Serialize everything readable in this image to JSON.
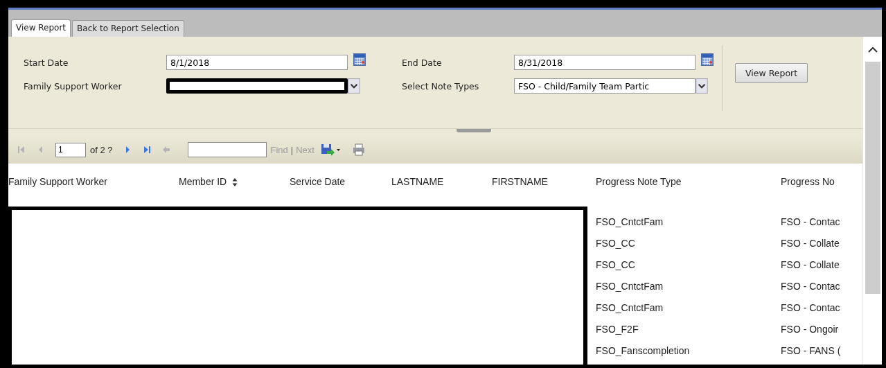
{
  "tabs": [
    {
      "label": "View Report",
      "selected": true
    },
    {
      "label": "Back to Report Selection",
      "selected": false
    }
  ],
  "parameters": {
    "start_date": {
      "label": "Start Date",
      "value": "8/1/2018"
    },
    "end_date": {
      "label": "End Date",
      "value": "8/31/2018"
    },
    "family_support_worker": {
      "label": "Family Support Worker",
      "redacted": true
    },
    "note_types": {
      "label": "Select Note Types",
      "value": "FSO - Child/Family Team Partic"
    },
    "button": "View Report"
  },
  "toolbar": {
    "nav": [
      {
        "kind": "first",
        "disabled": true
      },
      {
        "kind": "prev",
        "disabled": true
      }
    ],
    "page": "1",
    "page_count": "of 2 ?",
    "nav_after": [
      {
        "kind": "next",
        "disabled": false
      },
      {
        "kind": "last",
        "disabled": false
      },
      {
        "kind": "back",
        "disabled": true
      }
    ],
    "find": {
      "label": "Find",
      "disabled": true
    },
    "separator": "|",
    "next": {
      "label": "Next",
      "disabled": true
    }
  },
  "table": {
    "columns": [
      {
        "label": "Family Support Worker",
        "sortable": false
      },
      {
        "label": "Member ID",
        "sortable": true
      },
      {
        "label": "Service Date",
        "sortable": false
      },
      {
        "label": "LASTNAME",
        "sortable": false
      },
      {
        "label": "FIRSTNAME",
        "sortable": false
      },
      {
        "label": "Progress Note Type",
        "sortable": false
      },
      {
        "label": "Progress No",
        "sortable": false
      }
    ],
    "redacted": true,
    "rows": [
      {
        "progress_note_type": "FSO_CntctFam",
        "progress_note": "FSO - Contac"
      },
      {
        "progress_note_type": "FSO_CC",
        "progress_note": "FSO - Collate"
      },
      {
        "progress_note_type": "FSO_CC",
        "progress_note": "FSO - Collate"
      },
      {
        "progress_note_type": "FSO_CntctFam",
        "progress_note": "FSO - Contac"
      },
      {
        "progress_note_type": "FSO_CntctFam",
        "progress_note": "FSO - Contac"
      },
      {
        "progress_note_type": "FSO_F2F",
        "progress_note": "FSO - Ongoir"
      },
      {
        "progress_note_type": "FSO_Fanscompletion",
        "progress_note": "FSO - FANS ("
      }
    ]
  }
}
